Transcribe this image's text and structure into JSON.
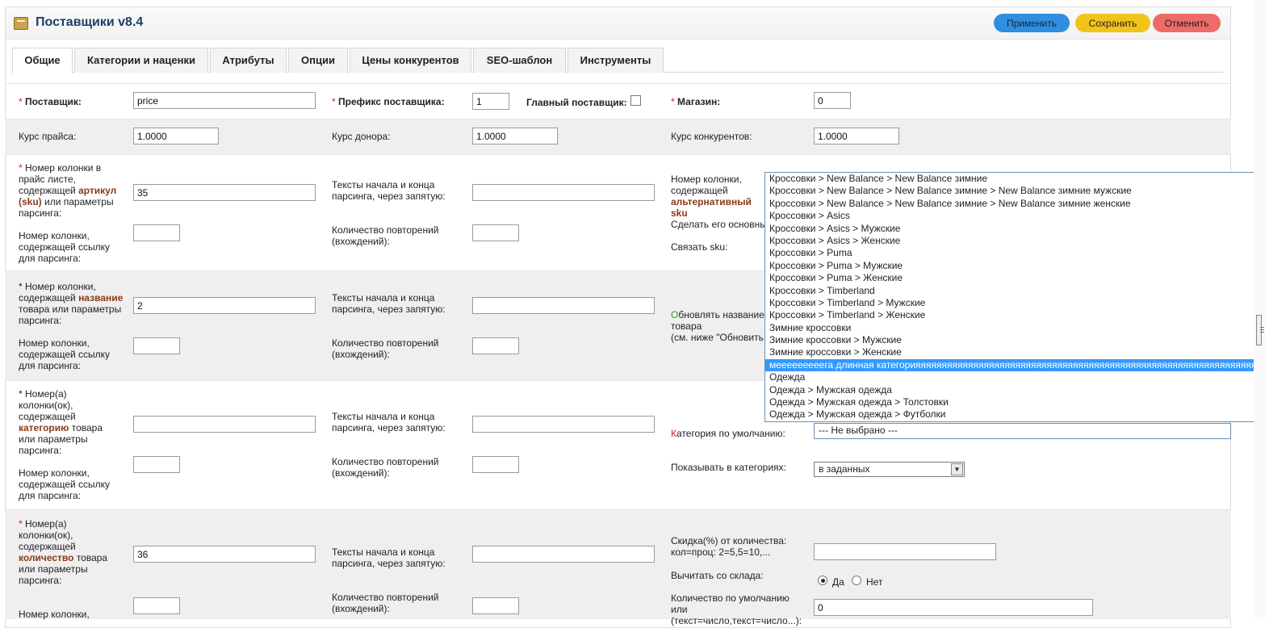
{
  "header": {
    "title": "Поставщики v8.4",
    "icon": "package-icon",
    "buttons": {
      "apply": "Применить",
      "save": "Сохранить",
      "cancel": "Отменить"
    },
    "colors": {
      "apply": "#2f8fe0",
      "save": "#f0c419",
      "cancel": "#ef6b67"
    }
  },
  "tabs": [
    "Общие",
    "Категории и наценки",
    "Атрибуты",
    "Опции",
    "Цены конкурентов",
    "SEO-шаблон",
    "Инструменты"
  ],
  "active_tab": "Общие",
  "row1": {
    "supplier_label": "Поставщик:",
    "supplier_value": "price",
    "prefix_label": "Префикс поставщика:",
    "prefix_value": "1",
    "main_supplier_label": "Главный поставщик:",
    "store_label": "Магазин:",
    "store_value": "0"
  },
  "row2": {
    "price_rate_label": "Курс прайса:",
    "price_rate_value": "1.0000",
    "donor_rate_label": "Курс донора:",
    "donor_rate_value": "1.0000",
    "competitor_rate_label": "Курс конкурентов:",
    "competitor_rate_value": "1.0000"
  },
  "row3": {
    "col_label_1": "Номер колонки в прайс листе, содержащей",
    "col_label_bold": "артикул (sku)",
    "col_label_2": "или параметры парсинга:",
    "col_value": "35",
    "link_col_label": "Номер колонки, содержащей ссылку для парсинга:",
    "texts_label": "Тексты начала и конца парсинга, через запятую:",
    "repeat_label": "Количество повторений (вхождений):",
    "alt_label_1": "Номер колонки, содержащей",
    "alt_label_bold": "альтернативный sku",
    "make_main_label": "Сделать его основны",
    "link_sku_label": "Связать sku:"
  },
  "row4": {
    "col_label_1": "Номер колонки, содержащей",
    "col_label_bold": "название",
    "col_label_2": "товара или параметры парсинга:",
    "col_value": "2",
    "link_col_label": "Номер колонки, содержащей ссылку для парсинга:",
    "texts_label": "Тексты начала и конца парсинга, через запятую:",
    "repeat_label": "Количество повторений (вхождений):",
    "update_name_o": "О",
    "update_name_rest": "бновлять название",
    "update_name_2": "товара",
    "update_name_3": "(см. ниже \"Обновить"
  },
  "row5": {
    "col_label_1": "Номер(а) колонки(ок), содержащей",
    "col_label_bold": "категорию",
    "col_label_2": "товара или параметры парсинга:",
    "link_col_label": "Номер колонки, содержащей ссылку для парсинга:",
    "texts_label": "Тексты начала и конца парсинга, через запятую:",
    "repeat_label": "Количество повторений (вхождений):",
    "default_cat_k": "К",
    "default_cat_rest": "атегория по умолчанию:",
    "default_cat_value": "--- Не выбрано ---",
    "show_in_label": "Показывать в категориях:",
    "show_in_value": "в заданных"
  },
  "row6": {
    "col_label_1": "Номер(а) колонки(ок), содержащей",
    "col_label_bold": "количество",
    "col_label_2": "товара или параметры парсинга:",
    "col_value": "36",
    "link_col_label": "Номер колонки,",
    "texts_label": "Тексты начала и конца парсинга, через запятую:",
    "repeat_label": "Количество повторений (вхождений):",
    "discount_label": "Скидка(%) от количества: кол=проц: 2=5,5=10,...",
    "subtract_label": "Вычитать со склада:",
    "yes": "Да",
    "no": "Нет",
    "default_qty_label": "Количество по умолчанию или",
    "default_qty_cut": "(текст=число,текст=число...):",
    "default_qty_value": "0"
  },
  "dropdown_options": [
    "Кроссовки > New Balance > New Balance зимние",
    "Кроссовки > New Balance > New Balance зимние > New Balance зимние мужские",
    "Кроссовки > New Balance > New Balance зимние > New Balance зимние женские",
    "Кроссовки > Asics",
    "Кроссовки > Asics > Мужские",
    "Кроссовки > Asics > Женские",
    "Кроссовки > Puma",
    "Кроссовки > Puma > Мужские",
    "Кроссовки > Puma > Женские",
    "Кроссовки > Timberland",
    "Кроссовки > Timberland > Мужские",
    "Кроссовки > Timberland > Женские",
    "Зимние кроссовки",
    "Зимние кроссовки > Мужские",
    "Зимние кроссовки > Женские",
    "мееееееееега длинная категорияяяяяяяяяяяяяяяяяяяяяяяяяяяяяяяяяяяяяяяяяяяяяяяяяяяяяяяяяяяяяяяяяяяяяяяя",
    "Одежда",
    "Одежда > Мужская одежда",
    "Одежда > Мужская одежда > Толстовки",
    "Одежда > Мужская одежда > Футболки"
  ],
  "dropdown_selected_index": 15
}
